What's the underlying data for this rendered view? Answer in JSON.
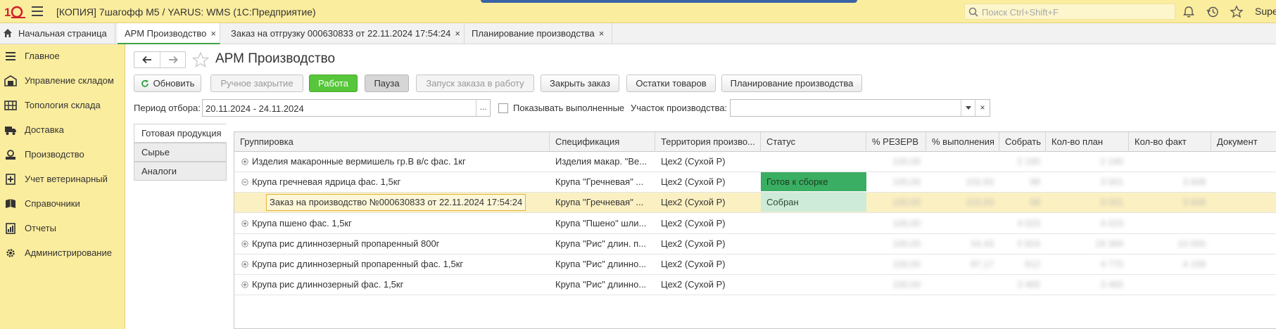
{
  "app": {
    "title": "[КОПИЯ] 7шагофф М5 / YARUS: WMS  (1С:Предприятие)",
    "search_placeholder": "Поиск Ctrl+Shift+F",
    "user": "Supervisor"
  },
  "tabs": [
    {
      "label": "Начальная страница"
    },
    {
      "label": "АРМ Производство",
      "close": "×"
    },
    {
      "label": "Заказ на отгрузку 000630833 от 22.11.2024 17:54:24",
      "close": "×"
    },
    {
      "label": "Планирование производства",
      "close": "×"
    }
  ],
  "sidebar": {
    "items": [
      {
        "label": "Главное",
        "icon": "menu-icon"
      },
      {
        "label": "Управление складом",
        "icon": "warehouse-icon"
      },
      {
        "label": "Топология склада",
        "icon": "topology-icon"
      },
      {
        "label": "Доставка",
        "icon": "truck-icon"
      },
      {
        "label": "Производство",
        "icon": "production-icon"
      },
      {
        "label": "Учет ветеринарный",
        "icon": "vet-icon"
      },
      {
        "label": "Справочники",
        "icon": "book-icon"
      },
      {
        "label": "Отчеты",
        "icon": "report-icon"
      },
      {
        "label": "Администрирование",
        "icon": "gear-icon"
      }
    ]
  },
  "page": {
    "title": "АРМ Производство"
  },
  "toolbar": {
    "refresh": "Обновить",
    "manual_close": "Ручное закрытие",
    "work": "Работа",
    "pause": "Пауза",
    "launch": "Запуск заказа в работу",
    "close_order": "Закрыть заказ",
    "stock": "Остатки товаров",
    "planning": "Планирование производства"
  },
  "filters": {
    "period_label": "Период отбора:",
    "period_value": "20.11.2024 - 24.11.2024",
    "period_button": "...",
    "show_done_label": "Показывать выполненные",
    "show_done_checked": false,
    "area_label": "Участок производства:",
    "area_value": "",
    "clear": "×"
  },
  "side_tabs": [
    {
      "label": "Готовая продукция"
    },
    {
      "label": "Сырье"
    },
    {
      "label": "Аналоги"
    }
  ],
  "table": {
    "columns": [
      "Группировка",
      "Спецификация",
      "Территория произво...",
      "Статус",
      "% РЕЗЕРВ",
      "% выполнения",
      "Собрать",
      "Кол-во план",
      "Кол-во факт",
      "Документ"
    ],
    "rows": [
      {
        "group": "Изделия макаронные вермишель гр.В в/с фас. 1кг",
        "spec": "Изделия макар. \"Ве...",
        "territory": "Цех2 (Сухой Р)",
        "status": "",
        "reserve": "100,00",
        "done": "",
        "collect": "2 190",
        "plan": "2 190",
        "fact": "",
        "doc": "",
        "expander": "plus"
      },
      {
        "group": "Крупа гречневая ядрица фас. 1,5кг",
        "spec": "Крупа \"Гречневая\" ...",
        "territory": "Цех2 (Сухой Р)",
        "status": "Готов к сборке",
        "reserve": "100,00",
        "done": "102,83",
        "collect": "98",
        "plan": "3 001",
        "fact": "3 608",
        "doc": "",
        "expander": "minus"
      },
      {
        "group": "Заказ на производство №000630833 от 22.11.2024 17:54:24",
        "spec": "Крупа \"Гречневая\" ...",
        "territory": "Цех2 (Сухой Р)",
        "status": "Собран",
        "reserve": "100,00",
        "done": "102,83",
        "collect": "98",
        "plan": "3 001",
        "fact": "3 608",
        "doc": "",
        "expander": "none"
      },
      {
        "group": "Крупа пшено фас. 1,5кг",
        "spec": "Крупа \"Пшено\" шли...",
        "territory": "Цех2 (Сухой Р)",
        "status": "",
        "reserve": "100,00",
        "done": "",
        "collect": "4 023",
        "plan": "4 023",
        "fact": "",
        "doc": "",
        "expander": "plus"
      },
      {
        "group": "Крупа рис длиннозерный пропаренный 800г",
        "spec": "Крупа \"Рис\" длин. п...",
        "territory": "Цех2 (Сухой Р)",
        "status": "",
        "reserve": "100,00",
        "done": "54,43",
        "collect": "5 924",
        "plan": "19 394",
        "fact": "10 000",
        "doc": "",
        "expander": "plus"
      },
      {
        "group": "Крупа рис длиннозерный пропаренный фас. 1,5кг",
        "spec": "Крупа \"Рис\" длинно...",
        "territory": "Цех2 (Сухой Р)",
        "status": "",
        "reserve": "100,00",
        "done": "87,17",
        "collect": "612",
        "plan": "4 770",
        "fact": "4 158",
        "doc": "",
        "expander": "plus"
      },
      {
        "group": "Крупа рис длиннозерный фас. 1,5кг",
        "spec": "Крупа \"Рис\" длинно...",
        "territory": "Цех2 (Сухой Р)",
        "status": "",
        "reserve": "100,00",
        "done": "",
        "collect": "3 465",
        "plan": "3 465",
        "fact": "",
        "doc": "",
        "expander": "plus"
      }
    ]
  },
  "colors": {
    "topbar": "#fbed9e",
    "accent_green": "#57c63a",
    "status_ready": "#3aae62",
    "status_collected": "#cdebd8",
    "selected_row": "#fbf0c2"
  }
}
